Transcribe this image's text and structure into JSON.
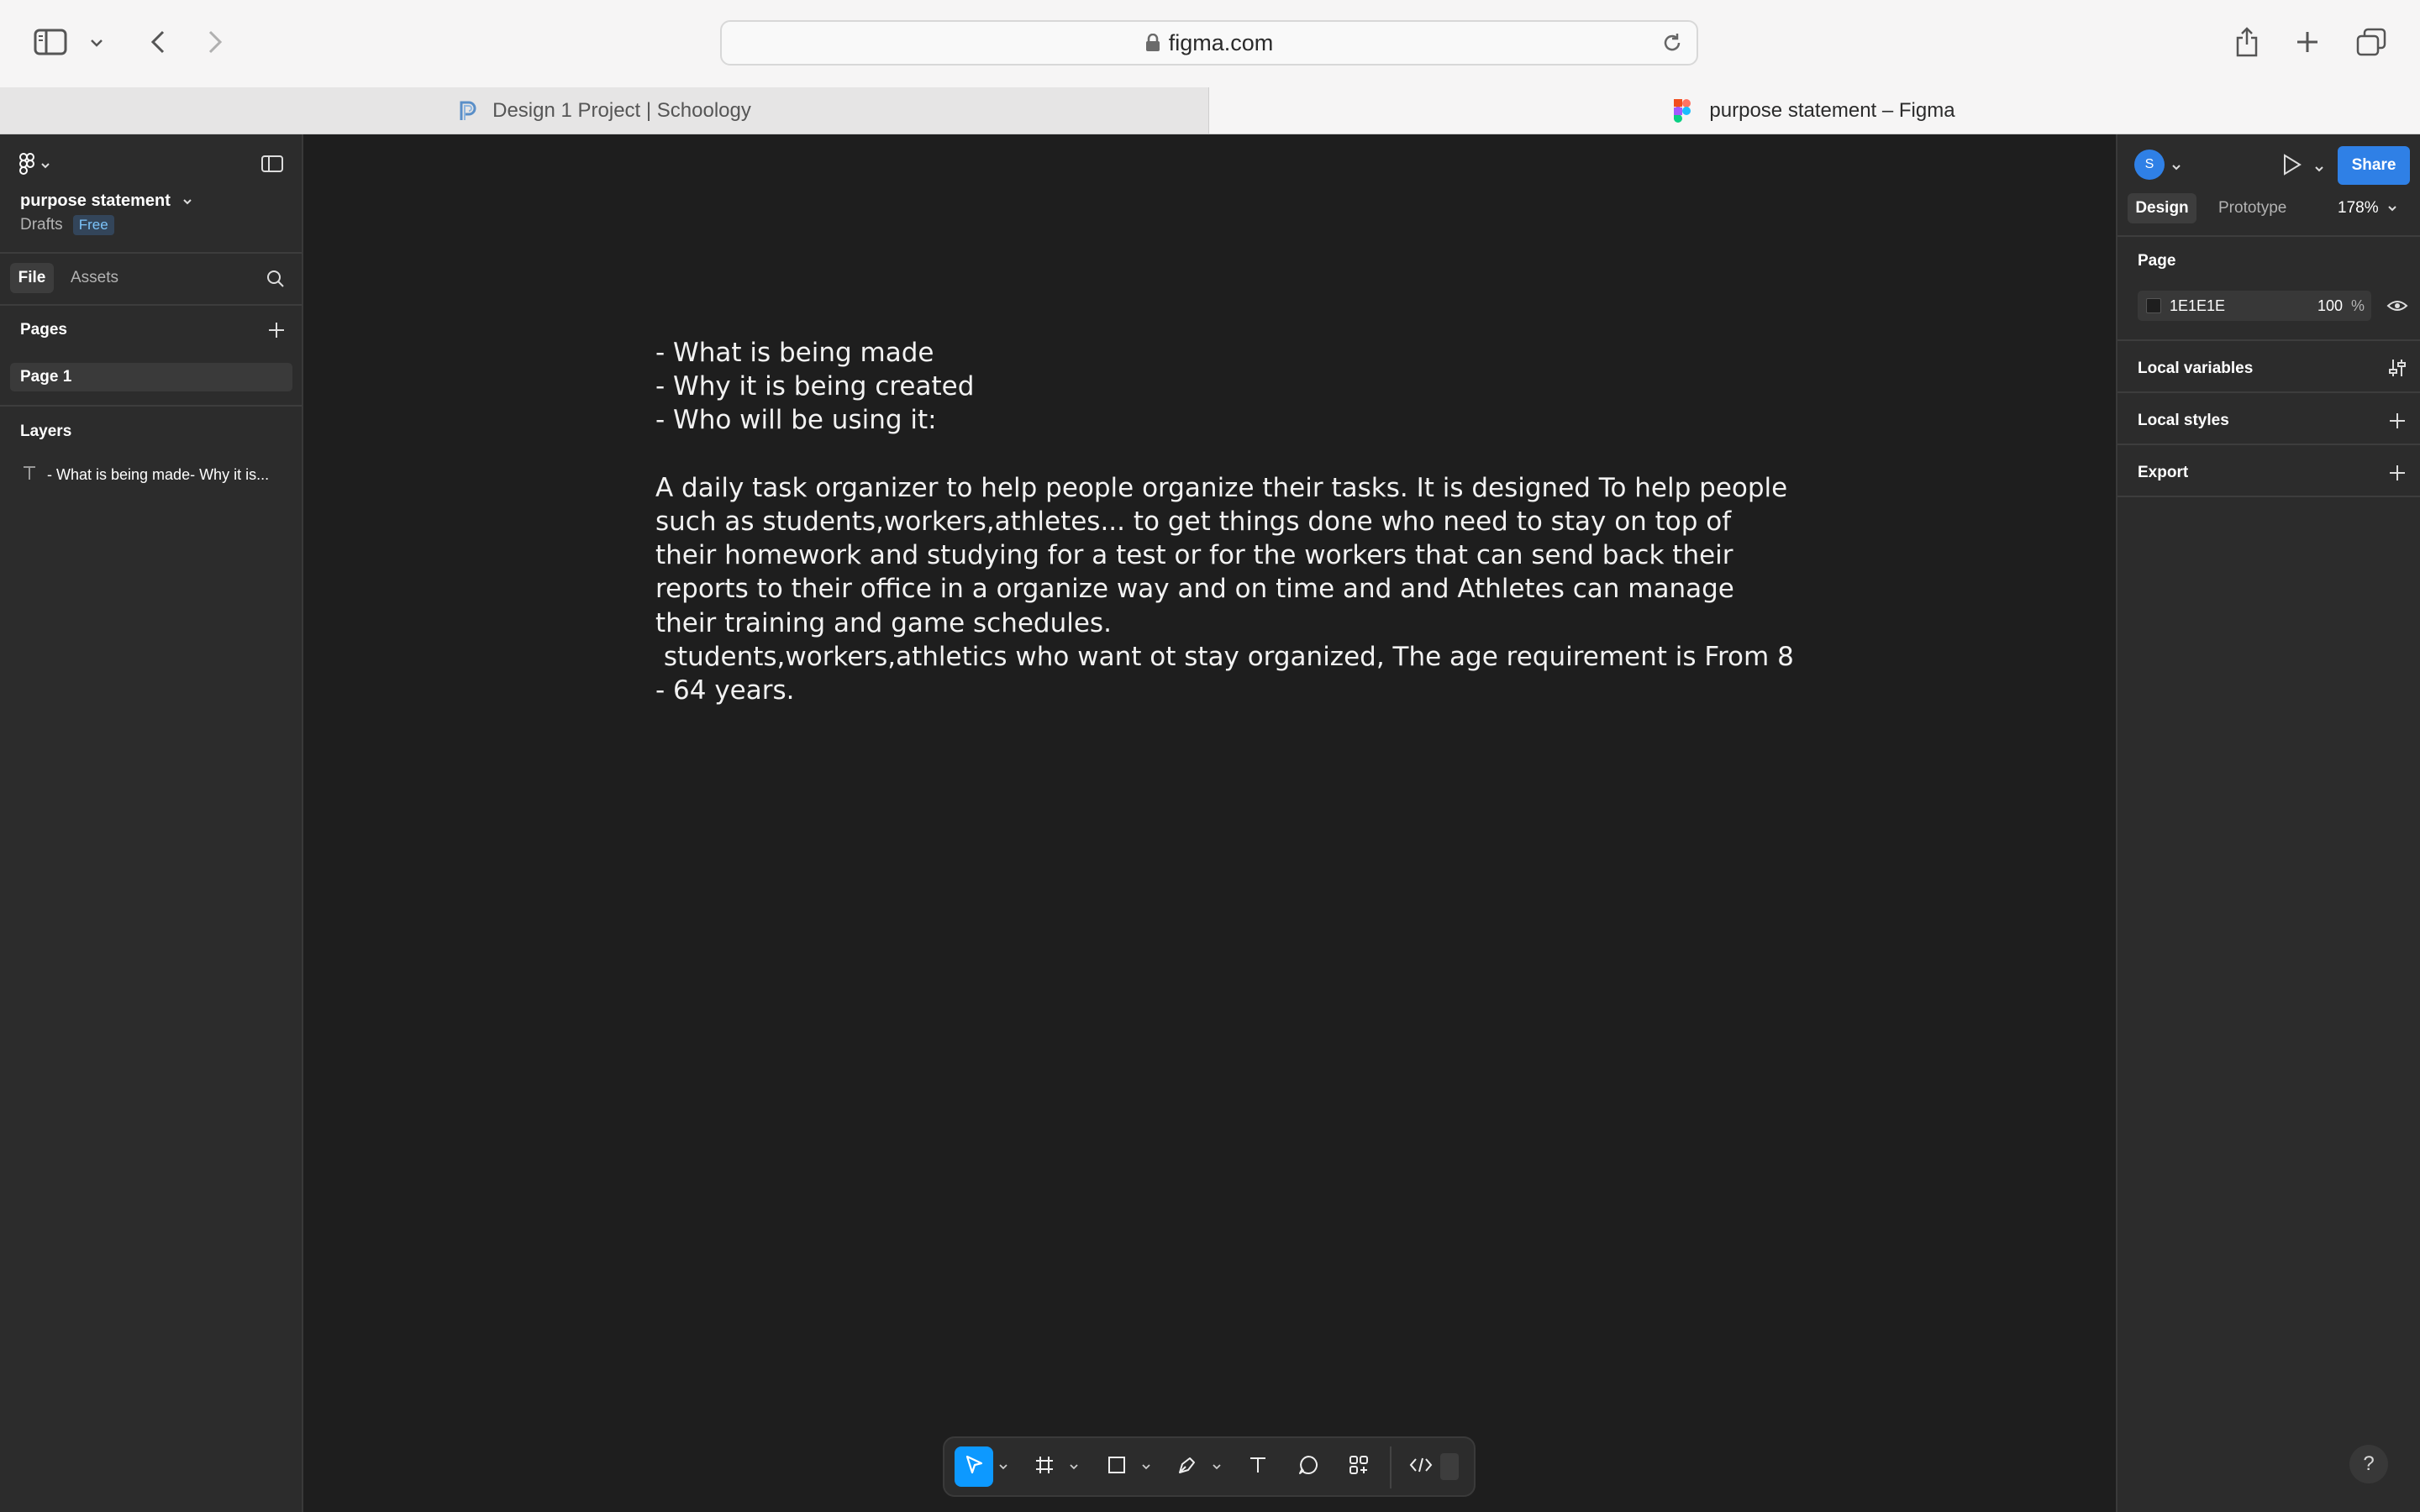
{
  "browser": {
    "url": "figma.com",
    "tabs": [
      {
        "label": "Design 1 Project | Schoology",
        "active": false
      },
      {
        "label": "purpose statement – Figma",
        "active": true
      }
    ]
  },
  "figma": {
    "file_name": "purpose statement",
    "location": "Drafts",
    "plan_badge": "Free",
    "left_tabs": {
      "file": "File",
      "assets": "Assets"
    },
    "pages_heading": "Pages",
    "pages": [
      "Page 1"
    ],
    "layers_heading": "Layers",
    "layers": [
      {
        "label": "- What is being made- Why it is..."
      }
    ],
    "canvas_text": "- What is being made\n- Why it is being created\n- Who will be using it:\n\nA daily task organizer to help people organize their tasks. It is designed To help people such as students,workers,athletes... to get things done who need to stay on top of their homework and studying for a test or for the workers that can send back their reports to their office in a organize way and on time and and Athletes can manage their training and game schedules.\n students,workers,athletics who want ot stay organized, The age requirement is From 8 - 64 years.",
    "avatar_initial": "S",
    "share_label": "Share",
    "right_tabs": {
      "design": "Design",
      "prototype": "Prototype"
    },
    "zoom": "178%",
    "page_section": "Page",
    "page_color": "1E1E1E",
    "page_opacity": "100",
    "opacity_unit": "%",
    "local_variables": "Local variables",
    "local_styles": "Local styles",
    "export": "Export",
    "help": "?"
  },
  "colors": {
    "canvas_bg": "#1e1e1e",
    "panel_bg": "#2c2c2c",
    "accent": "#0d99ff",
    "share_bg": "#2f80e6"
  }
}
